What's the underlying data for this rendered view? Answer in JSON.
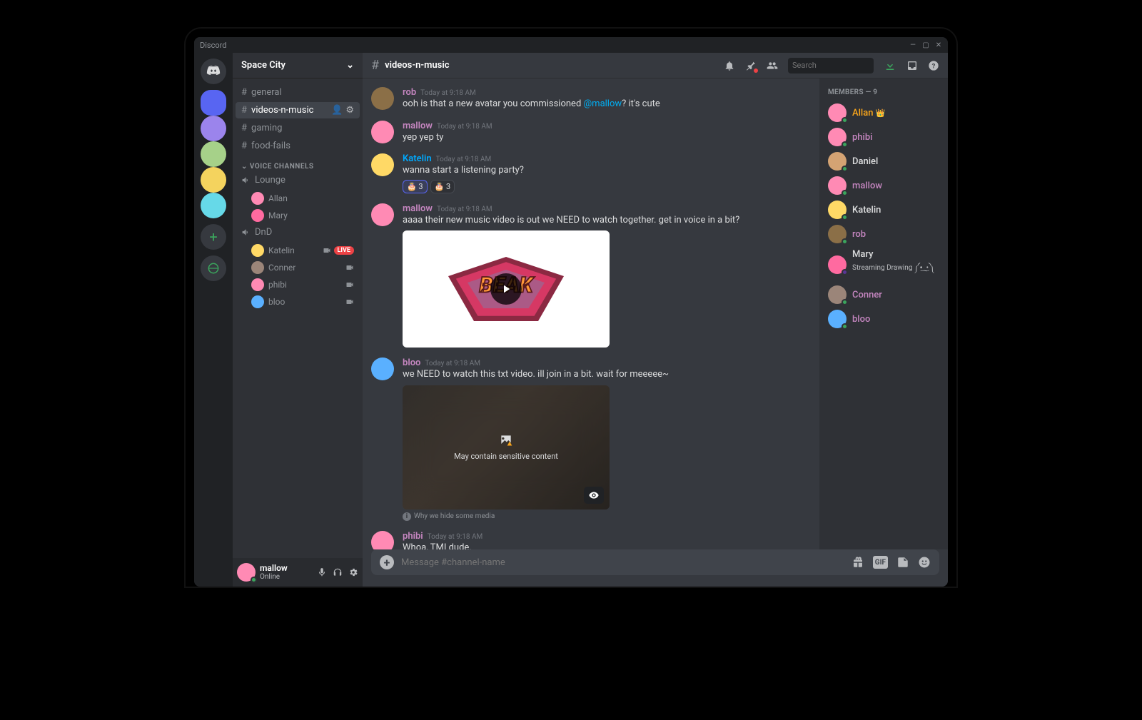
{
  "titlebar": {
    "app_name": "Discord"
  },
  "server": {
    "name": "Space City"
  },
  "channels": {
    "text": [
      {
        "name": "general"
      },
      {
        "name": "videos-n-music",
        "active": true
      },
      {
        "name": "gaming"
      },
      {
        "name": "food-fails"
      }
    ],
    "voice_header": "VOICE CHANNELS",
    "voice": [
      {
        "name": "Lounge",
        "users": [
          {
            "name": "Allan"
          },
          {
            "name": "Mary"
          }
        ]
      },
      {
        "name": "DnD",
        "users": [
          {
            "name": "Katelin",
            "live": true,
            "live_label": "LIVE",
            "cam": true
          },
          {
            "name": "Conner",
            "cam": true
          },
          {
            "name": "phibi",
            "cam": true
          },
          {
            "name": "bloo",
            "cam": true
          }
        ]
      }
    ]
  },
  "user_panel": {
    "name": "mallow",
    "status": "Online"
  },
  "channel_header": {
    "name": "videos-n-music",
    "search_placeholder": "Search"
  },
  "messages": [
    {
      "author": "rob",
      "color": "#c586c0",
      "ts": "Today at 9:18 AM",
      "text_pre": "ooh is that a new avatar you commissioned ",
      "mention": "@mallow",
      "text_post": "? it's cute"
    },
    {
      "author": "mallow",
      "color": "#c586c0",
      "ts": "Today at 9:18 AM",
      "text": "yep yep ty"
    },
    {
      "author": "Katelin",
      "color": "#00a8fc",
      "ts": "Today at 9:18 AM",
      "text": "wanna start a listening party?",
      "reactions": [
        {
          "emoji": "🎂",
          "count": 3,
          "me": true
        },
        {
          "emoji": "🎂",
          "count": 3
        }
      ]
    },
    {
      "author": "mallow",
      "color": "#c586c0",
      "ts": "Today at 9:18 AM",
      "text": "aaaa their new music video is out we NEED to watch together. get in voice in a bit?",
      "video": true
    },
    {
      "author": "bloo",
      "color": "#c586c0",
      "ts": "Today at 9:18 AM",
      "text": "we NEED to watch this txt video. ill join in a bit. wait for meeeee~",
      "sensitive": true,
      "sensitive_label": "May contain sensitive content",
      "hide_link": "Why we hide some media"
    },
    {
      "author": "phibi",
      "color": "#c586c0",
      "ts": "Today at 9:18 AM",
      "text": "Whoa, TMI dude."
    }
  ],
  "input": {
    "placeholder": "Message #channel-name"
  },
  "members_panel": {
    "header": "MEMBERS — 9",
    "list": [
      {
        "name": "Allan",
        "color": "#faa61a",
        "crown": true,
        "status": "on"
      },
      {
        "name": "phibi",
        "color": "#c586c0",
        "status": "on"
      },
      {
        "name": "Daniel",
        "color": "#dcddde",
        "status": "on"
      },
      {
        "name": "mallow",
        "color": "#c586c0",
        "status": "on"
      },
      {
        "name": "Katelin",
        "color": "#dcddde",
        "status": "on"
      },
      {
        "name": "rob",
        "color": "#c586c0",
        "status": "on"
      },
      {
        "name": "Mary",
        "color": "#dcddde",
        "status": "str",
        "sub": "Streaming Drawing ༼•͟ ͜ •༽"
      },
      {
        "name": "Conner",
        "color": "#c586c0",
        "status": "on"
      },
      {
        "name": "bloo",
        "color": "#c586c0",
        "status": "on"
      }
    ]
  },
  "avatars": {
    "rob": "#8b6f47",
    "mallow": "#ff8ab4",
    "Katelin": "#ffd966",
    "bloo": "#5ab0ff",
    "phibi": "#ff8ab4",
    "Allan": "#ff8ab4",
    "Mary": "#ff6aa0",
    "Daniel": "#d4a373",
    "Conner": "#9b8579"
  },
  "server_colors": [
    "#5865f2",
    "#9b84ec",
    "#a6d189",
    "#f4d35e",
    "#66d9e8"
  ]
}
